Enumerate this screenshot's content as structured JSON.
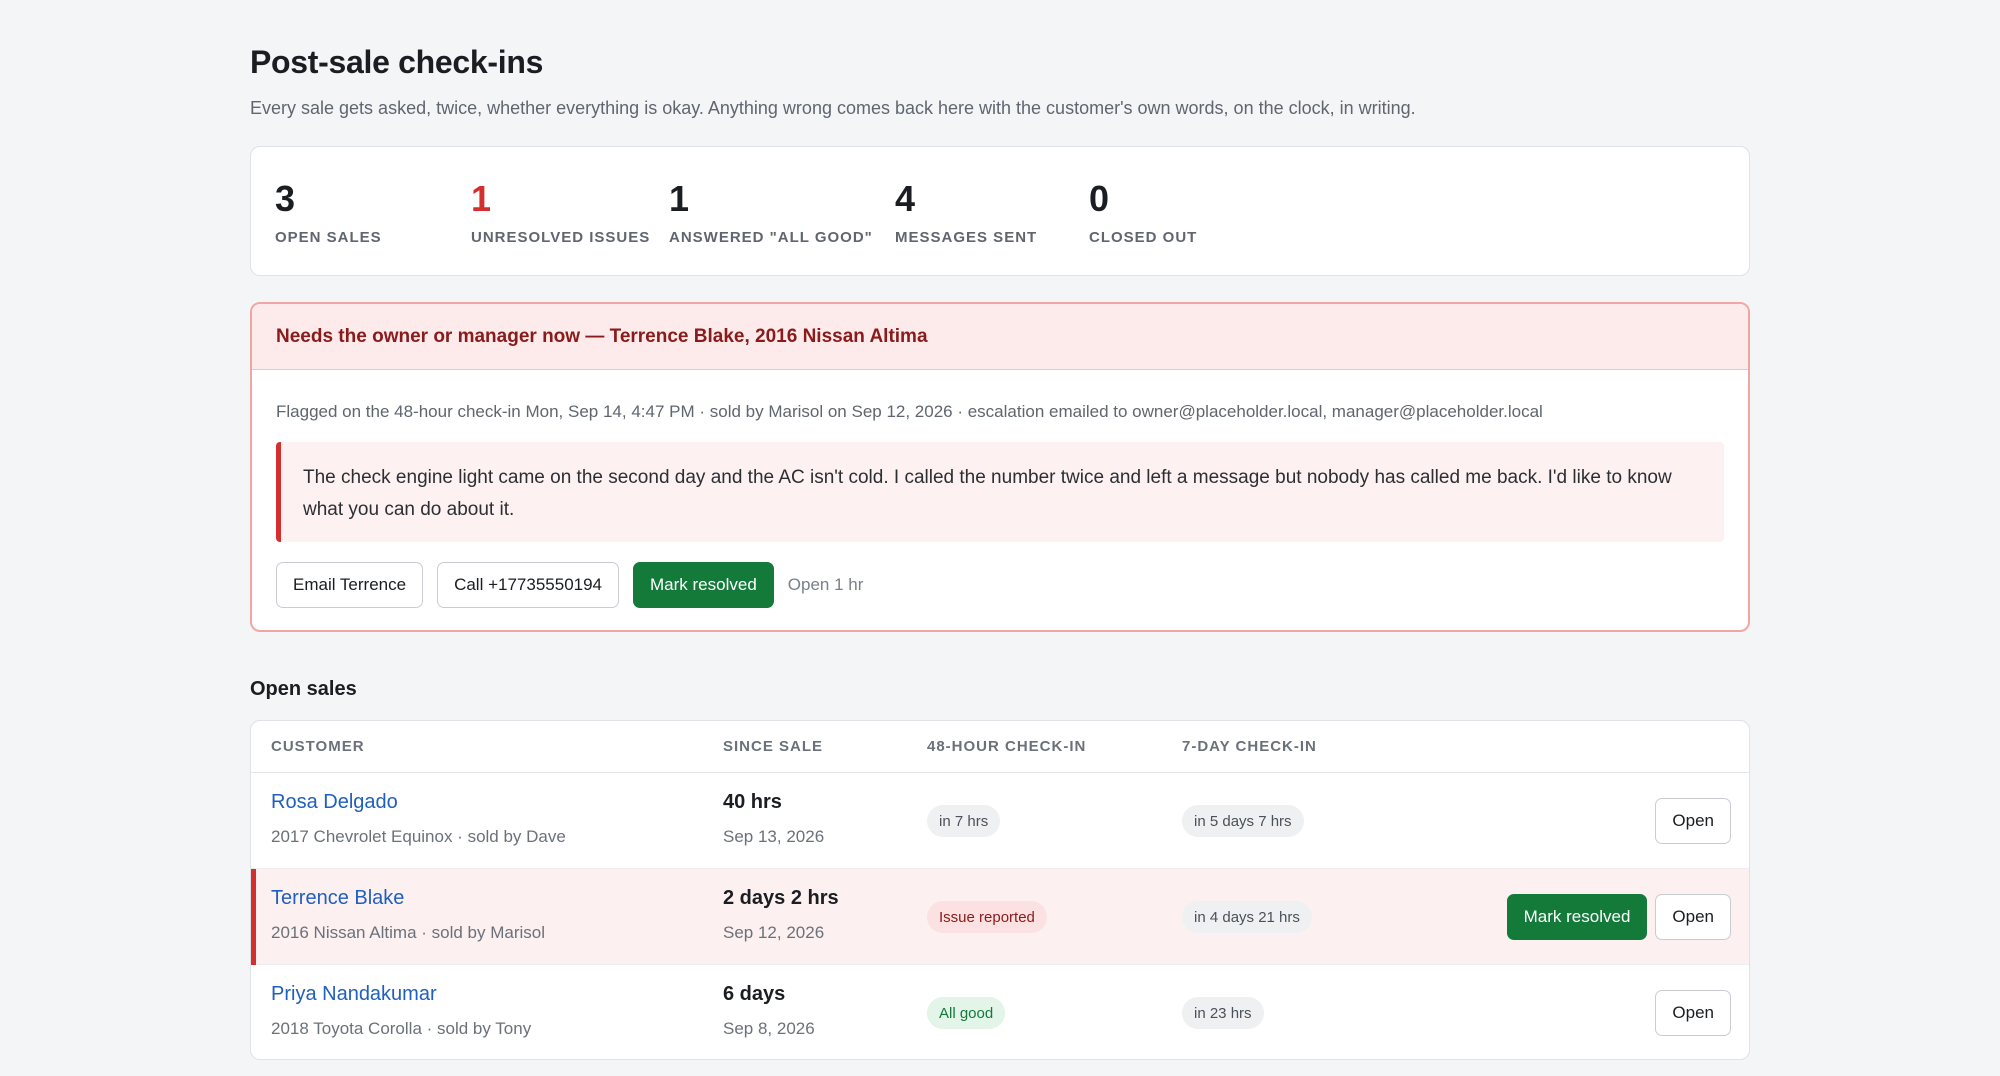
{
  "header": {
    "title": "Post-sale check-ins",
    "subtitle": "Every sale gets asked, twice, whether everything is okay. Anything wrong comes back here with the customer's own words, on the clock, in writing."
  },
  "stats": [
    {
      "value": "3",
      "label": "OPEN SALES"
    },
    {
      "value": "1",
      "label": "UNRESOLVED ISSUES"
    },
    {
      "value": "1",
      "label": "ANSWERED \"ALL GOOD\""
    },
    {
      "value": "4",
      "label": "MESSAGES SENT"
    },
    {
      "value": "0",
      "label": "CLOSED OUT"
    }
  ],
  "colors": {
    "accent_red": "#d32f2f",
    "action_green": "#137a3a",
    "link_blue": "#1f5fbf"
  },
  "alert": {
    "title": "Needs the owner or manager now — Terrence Blake, 2016 Nissan Altima",
    "meta": "Flagged on the 48-hour check-in Mon, Sep 14, 4:47 PM · sold by Marisol on Sep 12, 2026 · escalation emailed to owner@placeholder.local, manager@placeholder.local",
    "quote": "The check engine light came on the second day and the AC isn't cold. I called the number twice and left a message but nobody has called me back. I'd like to know what you can do about it.",
    "email_label": "Email Terrence",
    "call_label": "Call +17735550194",
    "resolve_label": "Mark resolved",
    "open_time": "Open 1 hr"
  },
  "open_sales": {
    "title": "Open sales",
    "columns": [
      "CUSTOMER",
      "SINCE SALE",
      "48-HOUR CHECK-IN",
      "7-DAY CHECK-IN"
    ],
    "rows": [
      {
        "name": "Rosa Delgado",
        "sub": "2017 Chevrolet Equinox · sold by Dave",
        "since": "40 hrs",
        "date": "Sep 13, 2026",
        "check48": "in 7 hrs",
        "check7": "in 5 days 7 hrs",
        "open_label": "Open"
      },
      {
        "name": "Terrence Blake",
        "sub": "2016 Nissan Altima · sold by Marisol",
        "since": "2 days 2 hrs",
        "date": "Sep 12, 2026",
        "check48": "Issue reported",
        "check7": "in 4 days 21 hrs",
        "resolve_label": "Mark resolved",
        "open_label": "Open"
      },
      {
        "name": "Priya Nandakumar",
        "sub": "2018 Toyota Corolla · sold by Tony",
        "since": "6 days",
        "date": "Sep 8, 2026",
        "check48": "All good",
        "check7": "in 23 hrs",
        "open_label": "Open"
      }
    ]
  }
}
